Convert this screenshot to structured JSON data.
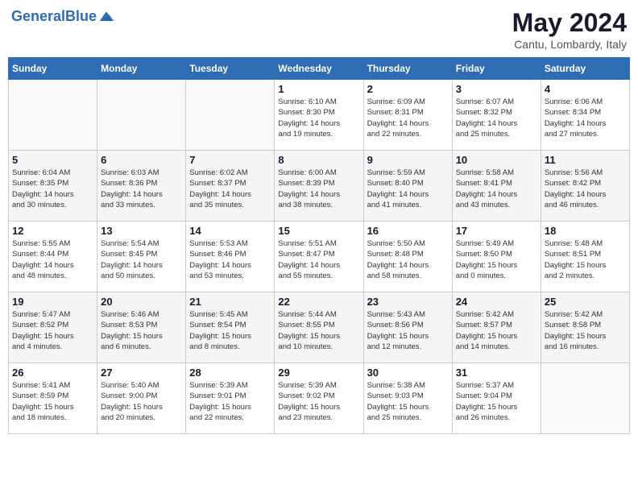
{
  "header": {
    "logo_text_general": "General",
    "logo_text_blue": "Blue",
    "month_title": "May 2024",
    "location": "Cantu, Lombardy, Italy"
  },
  "weekdays": [
    "Sunday",
    "Monday",
    "Tuesday",
    "Wednesday",
    "Thursday",
    "Friday",
    "Saturday"
  ],
  "weeks": [
    [
      {
        "day": "",
        "info": ""
      },
      {
        "day": "",
        "info": ""
      },
      {
        "day": "",
        "info": ""
      },
      {
        "day": "1",
        "info": "Sunrise: 6:10 AM\nSunset: 8:30 PM\nDaylight: 14 hours\nand 19 minutes."
      },
      {
        "day": "2",
        "info": "Sunrise: 6:09 AM\nSunset: 8:31 PM\nDaylight: 14 hours\nand 22 minutes."
      },
      {
        "day": "3",
        "info": "Sunrise: 6:07 AM\nSunset: 8:32 PM\nDaylight: 14 hours\nand 25 minutes."
      },
      {
        "day": "4",
        "info": "Sunrise: 6:06 AM\nSunset: 8:34 PM\nDaylight: 14 hours\nand 27 minutes."
      }
    ],
    [
      {
        "day": "5",
        "info": "Sunrise: 6:04 AM\nSunset: 8:35 PM\nDaylight: 14 hours\nand 30 minutes."
      },
      {
        "day": "6",
        "info": "Sunrise: 6:03 AM\nSunset: 8:36 PM\nDaylight: 14 hours\nand 33 minutes."
      },
      {
        "day": "7",
        "info": "Sunrise: 6:02 AM\nSunset: 8:37 PM\nDaylight: 14 hours\nand 35 minutes."
      },
      {
        "day": "8",
        "info": "Sunrise: 6:00 AM\nSunset: 8:39 PM\nDaylight: 14 hours\nand 38 minutes."
      },
      {
        "day": "9",
        "info": "Sunrise: 5:59 AM\nSunset: 8:40 PM\nDaylight: 14 hours\nand 41 minutes."
      },
      {
        "day": "10",
        "info": "Sunrise: 5:58 AM\nSunset: 8:41 PM\nDaylight: 14 hours\nand 43 minutes."
      },
      {
        "day": "11",
        "info": "Sunrise: 5:56 AM\nSunset: 8:42 PM\nDaylight: 14 hours\nand 46 minutes."
      }
    ],
    [
      {
        "day": "12",
        "info": "Sunrise: 5:55 AM\nSunset: 8:44 PM\nDaylight: 14 hours\nand 48 minutes."
      },
      {
        "day": "13",
        "info": "Sunrise: 5:54 AM\nSunset: 8:45 PM\nDaylight: 14 hours\nand 50 minutes."
      },
      {
        "day": "14",
        "info": "Sunrise: 5:53 AM\nSunset: 8:46 PM\nDaylight: 14 hours\nand 53 minutes."
      },
      {
        "day": "15",
        "info": "Sunrise: 5:51 AM\nSunset: 8:47 PM\nDaylight: 14 hours\nand 55 minutes."
      },
      {
        "day": "16",
        "info": "Sunrise: 5:50 AM\nSunset: 8:48 PM\nDaylight: 14 hours\nand 58 minutes."
      },
      {
        "day": "17",
        "info": "Sunrise: 5:49 AM\nSunset: 8:50 PM\nDaylight: 15 hours\nand 0 minutes."
      },
      {
        "day": "18",
        "info": "Sunrise: 5:48 AM\nSunset: 8:51 PM\nDaylight: 15 hours\nand 2 minutes."
      }
    ],
    [
      {
        "day": "19",
        "info": "Sunrise: 5:47 AM\nSunset: 8:52 PM\nDaylight: 15 hours\nand 4 minutes."
      },
      {
        "day": "20",
        "info": "Sunrise: 5:46 AM\nSunset: 8:53 PM\nDaylight: 15 hours\nand 6 minutes."
      },
      {
        "day": "21",
        "info": "Sunrise: 5:45 AM\nSunset: 8:54 PM\nDaylight: 15 hours\nand 8 minutes."
      },
      {
        "day": "22",
        "info": "Sunrise: 5:44 AM\nSunset: 8:55 PM\nDaylight: 15 hours\nand 10 minutes."
      },
      {
        "day": "23",
        "info": "Sunrise: 5:43 AM\nSunset: 8:56 PM\nDaylight: 15 hours\nand 12 minutes."
      },
      {
        "day": "24",
        "info": "Sunrise: 5:42 AM\nSunset: 8:57 PM\nDaylight: 15 hours\nand 14 minutes."
      },
      {
        "day": "25",
        "info": "Sunrise: 5:42 AM\nSunset: 8:58 PM\nDaylight: 15 hours\nand 16 minutes."
      }
    ],
    [
      {
        "day": "26",
        "info": "Sunrise: 5:41 AM\nSunset: 8:59 PM\nDaylight: 15 hours\nand 18 minutes."
      },
      {
        "day": "27",
        "info": "Sunrise: 5:40 AM\nSunset: 9:00 PM\nDaylight: 15 hours\nand 20 minutes."
      },
      {
        "day": "28",
        "info": "Sunrise: 5:39 AM\nSunset: 9:01 PM\nDaylight: 15 hours\nand 22 minutes."
      },
      {
        "day": "29",
        "info": "Sunrise: 5:39 AM\nSunset: 9:02 PM\nDaylight: 15 hours\nand 23 minutes."
      },
      {
        "day": "30",
        "info": "Sunrise: 5:38 AM\nSunset: 9:03 PM\nDaylight: 15 hours\nand 25 minutes."
      },
      {
        "day": "31",
        "info": "Sunrise: 5:37 AM\nSunset: 9:04 PM\nDaylight: 15 hours\nand 26 minutes."
      },
      {
        "day": "",
        "info": ""
      }
    ]
  ]
}
